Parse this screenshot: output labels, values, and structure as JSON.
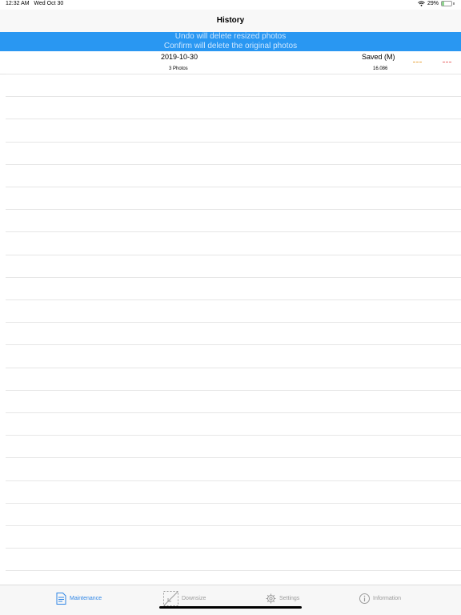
{
  "status_bar": {
    "time": "12:32 AM",
    "date": "Wed Oct 30",
    "battery": "29%",
    "battery_level": 0.29
  },
  "nav": {
    "title": "History"
  },
  "banner": {
    "line1": "Undo will delete resized photos",
    "line2": "Confirm will delete the original photos",
    "background": "#2997f2"
  },
  "history": [
    {
      "date": "2019-10-30",
      "photos": "3 Photos",
      "saved_label": "Saved (M)",
      "saved_value": "16.086"
    }
  ],
  "tabs": [
    {
      "label": "Maintenance",
      "icon": "maintenance-icon",
      "active": true
    },
    {
      "label": "Downsize",
      "icon": "downsize-icon",
      "active": false
    },
    {
      "label": "Settings",
      "icon": "gear-icon",
      "active": false
    },
    {
      "label": "Information",
      "icon": "info-icon",
      "active": false
    }
  ],
  "colors": {
    "accent": "#2f86e6",
    "inactive": "#9b9b9b",
    "undo_action": "#e8a640",
    "confirm_action": "#e86a6a"
  }
}
